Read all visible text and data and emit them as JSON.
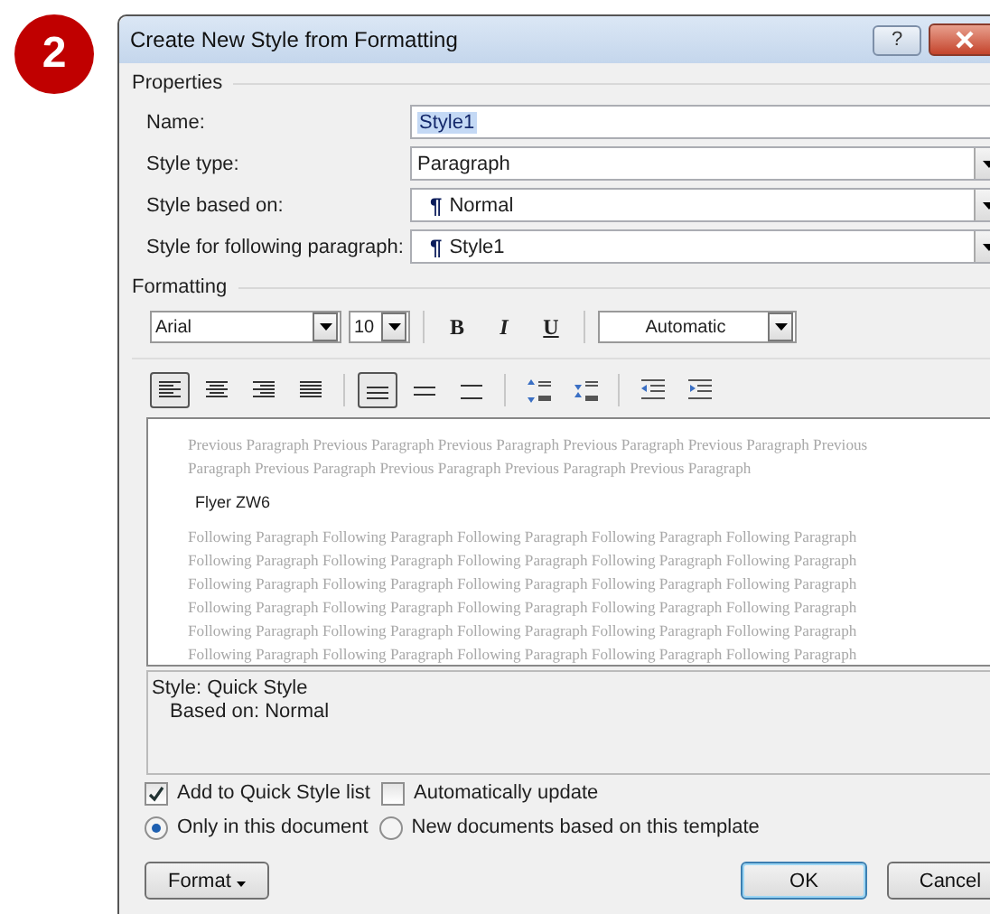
{
  "step_badge": "2",
  "window": {
    "title": "Create New Style from Formatting",
    "help": "?"
  },
  "properties": {
    "label": "Properties",
    "fields": [
      {
        "label": "Name:",
        "kind": "text",
        "value": "Style1",
        "highlighted": true
      },
      {
        "label": "Style type:",
        "kind": "dropdown",
        "value": "Paragraph",
        "highlighted": false
      },
      {
        "label": "Style based on:",
        "kind": "dropdown",
        "mark": "¶",
        "value": "Normal",
        "highlighted": false
      },
      {
        "label": "Style for following paragraph:",
        "kind": "dropdown",
        "mark": "¶",
        "value": "Style1",
        "highlighted": false
      }
    ]
  },
  "formatting": {
    "label": "Formatting",
    "font": "Arial",
    "size": "10",
    "styles": [
      {
        "kind": "bold",
        "glyph": "B"
      },
      {
        "kind": "italic",
        "glyph": "I"
      },
      {
        "kind": "underline",
        "glyph": "U"
      }
    ],
    "font_color": "Automatic",
    "alignment": [
      {
        "kind": "left",
        "selected": true
      },
      {
        "kind": "center",
        "selected": false
      },
      {
        "kind": "right",
        "selected": false
      },
      {
        "kind": "justify",
        "selected": false
      }
    ],
    "spacing": [
      {
        "kind": "single",
        "selected": true
      },
      {
        "kind": "onehalf",
        "selected": false
      },
      {
        "kind": "double",
        "selected": false
      }
    ],
    "paragraph_spacing": [
      {
        "kind": "increase"
      },
      {
        "kind": "decrease"
      }
    ],
    "indent": [
      {
        "kind": "decrease"
      },
      {
        "kind": "increase"
      }
    ]
  },
  "preview": {
    "previous": [
      "Previous Paragraph Previous Paragraph Previous Paragraph Previous Paragraph Previous Paragraph Previous",
      "Paragraph Previous Paragraph Previous Paragraph Previous Paragraph Previous Paragraph"
    ],
    "sample": "Flyer ZW6",
    "following": [
      "Following Paragraph Following Paragraph Following Paragraph Following Paragraph Following Paragraph",
      "Following Paragraph Following Paragraph Following Paragraph Following Paragraph Following Paragraph",
      "Following Paragraph Following Paragraph Following Paragraph Following Paragraph Following Paragraph",
      "Following Paragraph Following Paragraph Following Paragraph Following Paragraph Following Paragraph",
      "Following Paragraph Following Paragraph Following Paragraph Following Paragraph Following Paragraph",
      "Following Paragraph Following Paragraph Following Paragraph Following Paragraph Following Paragraph"
    ]
  },
  "description": [
    "Style: Quick Style",
    "Based on: Normal"
  ],
  "checkboxes": [
    {
      "label": "Add to Quick Style list",
      "checked": true
    },
    {
      "label": "Automatically update",
      "checked": false
    }
  ],
  "radios": [
    {
      "label": "Only in this document",
      "selected": true
    },
    {
      "label": "New documents based on this template",
      "selected": false
    }
  ],
  "buttons": [
    {
      "label": "Format",
      "kind": "menu"
    },
    {
      "label": "OK",
      "kind": "default"
    },
    {
      "label": "Cancel",
      "kind": "normal"
    }
  ]
}
